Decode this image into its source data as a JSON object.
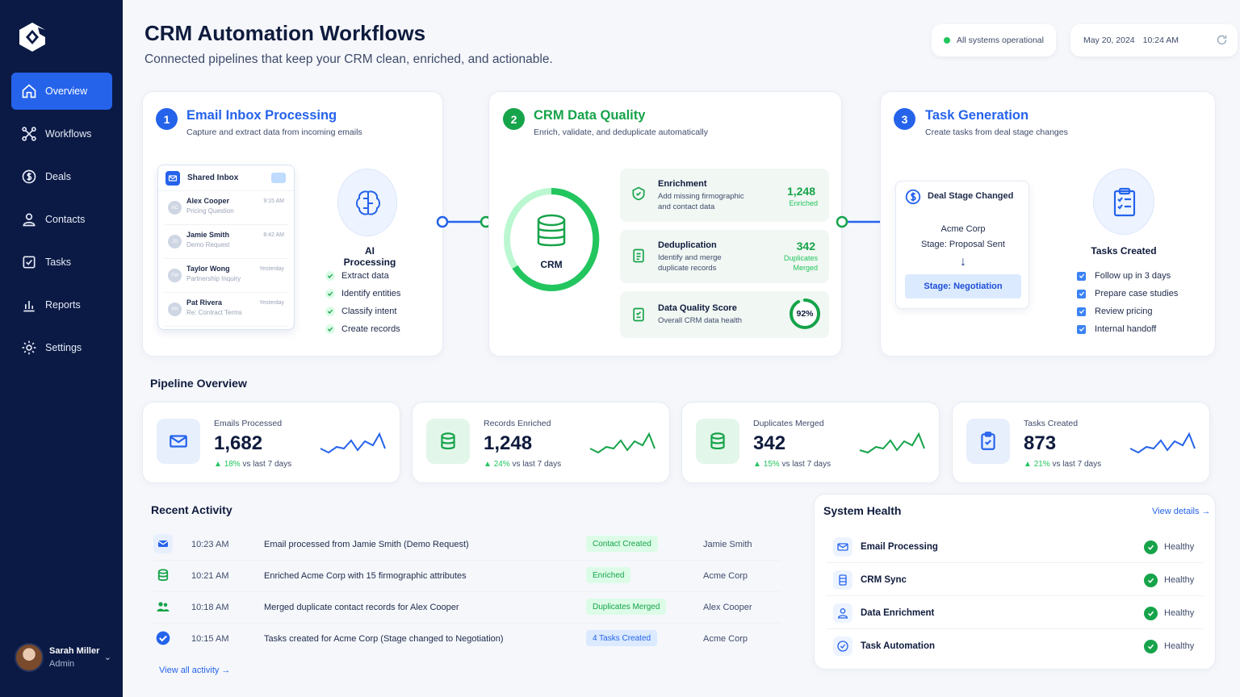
{
  "user": {
    "name": "Sarah Miller",
    "role": "Admin"
  },
  "nav": {
    "items": [
      {
        "label": "Overview",
        "icon": "home-icon",
        "active": true
      },
      {
        "label": "Workflows",
        "icon": "workflow-icon"
      },
      {
        "label": "Deals",
        "icon": "dollar-icon"
      },
      {
        "label": "Contacts",
        "icon": "user-icon"
      },
      {
        "label": "Tasks",
        "icon": "checkbox-icon"
      },
      {
        "label": "Reports",
        "icon": "bar-chart-icon"
      },
      {
        "label": "Settings",
        "icon": "gear-icon"
      }
    ]
  },
  "header": {
    "title": "CRM Automation Workflows",
    "subtitle": "Connected pipelines that keep your CRM clean, enriched, and actionable.",
    "status": "All systems operational",
    "date": "May 20, 2024",
    "time": "10:24 AM"
  },
  "steps": {
    "email": {
      "number": "1",
      "title": "Email Inbox Processing",
      "description": "Capture and extract data from incoming emails",
      "inbox_title": "Shared Inbox",
      "messages": [
        {
          "initials": "AC",
          "name": "Alex Cooper",
          "subject": "Pricing Question",
          "time": "9:15 AM"
        },
        {
          "initials": "JS",
          "name": "Jamie Smith",
          "subject": "Demo Request",
          "time": "8:42 AM"
        },
        {
          "initials": "TW",
          "name": "Taylor Wong",
          "subject": "Partnership Inquiry",
          "time": "Yesterday"
        },
        {
          "initials": "PR",
          "name": "Pat Rivera",
          "subject": "Re: Contract Terms",
          "time": "Yesterday"
        }
      ],
      "ai_title": "AI Processing",
      "ai_steps": [
        "Extract data",
        "Identify entities",
        "Classify intent",
        "Create records"
      ]
    },
    "crm": {
      "number": "2",
      "title": "CRM Data Quality",
      "description": "Enrich, validate, and deduplicate automatically",
      "hub_label": "CRM",
      "items": [
        {
          "title": "Enrichment",
          "sub1": "Add missing firmographic",
          "sub2": "and contact data",
          "value": "1,248",
          "cap1": "Enriched",
          "cap2": ""
        },
        {
          "title": "Deduplication",
          "sub1": "Identify and merge",
          "sub2": "duplicate records",
          "value": "342",
          "cap1": "Duplicates",
          "cap2": "Merged"
        }
      ],
      "score": {
        "title": "Data Quality Score",
        "sub": "Overall CRM data health",
        "value": "92%",
        "fraction": 0.92
      }
    },
    "tasks": {
      "number": "3",
      "title": "Task Generation",
      "description": "Create tasks from deal stage changes",
      "event_title": "Deal Stage Changed",
      "company": "Acme Corp",
      "from_stage": "Stage: Proposal Sent",
      "arrow": "↓",
      "to_stage": "Stage: Negotiation",
      "tasks_title": "Tasks Created",
      "task_items": [
        "Follow up in 3 days",
        "Prepare case studies",
        "Review pricing",
        "Internal handoff"
      ]
    }
  },
  "pipeline": {
    "title": "Pipeline Overview",
    "stats": [
      {
        "label": "Emails Processed",
        "value": "1,682",
        "change": "18%",
        "period": "vs last 7 days",
        "icon": "mail-icon"
      },
      {
        "label": "Records Enriched",
        "value": "1,248",
        "change": "24%",
        "period": "vs last 7 days",
        "icon": "database-icon"
      },
      {
        "label": "Duplicates Merged",
        "value": "342",
        "change": "15%",
        "period": "vs last 7 days",
        "icon": "merge-database-icon"
      },
      {
        "label": "Tasks Created",
        "value": "873",
        "change": "21%",
        "period": "vs last 7 days",
        "icon": "clipboard-icon"
      }
    ]
  },
  "activity": {
    "title": "Recent Activity",
    "rows": [
      {
        "time": "10:23 AM",
        "description": "Email processed from Jamie Smith (Demo Request)",
        "badge": "Contact Created",
        "entity": "Jamie Smith",
        "icon": "mail-icon"
      },
      {
        "time": "10:21 AM",
        "description": "Enriched Acme Corp with 15 firmographic attributes",
        "badge": "Enriched",
        "entity": "Acme Corp",
        "icon": "database-icon"
      },
      {
        "time": "10:18 AM",
        "description": "Merged duplicate contact records for Alex Cooper",
        "badge": "Duplicates Merged",
        "entity": "Alex Cooper",
        "icon": "users-icon"
      },
      {
        "time": "10:15 AM",
        "description": "Tasks created for Acme Corp (Stage changed to Negotiation)",
        "badge": "4 Tasks Created",
        "entity": "Acme Corp",
        "icon": "check-circle-icon"
      }
    ],
    "view_all": "View all activity →"
  },
  "health": {
    "title": "System Health",
    "view_details": "View details →",
    "rows": [
      {
        "name": "Email Processing",
        "status": "Healthy",
        "icon": "mail-icon"
      },
      {
        "name": "CRM Sync",
        "status": "Healthy",
        "icon": "database-icon"
      },
      {
        "name": "Data Enrichment",
        "status": "Healthy",
        "icon": "user-icon"
      },
      {
        "name": "Task Automation",
        "status": "Healthy",
        "icon": "check-circle-icon"
      }
    ]
  },
  "colors": {
    "blue": "#2563eb",
    "green": "#16a34a",
    "navy": "#0b1a45",
    "light_green": "#dcfce7",
    "light_blue": "#dbeafe"
  }
}
